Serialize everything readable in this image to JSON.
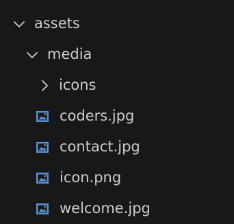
{
  "colors": {
    "background": "#181818",
    "text": "#cccccc",
    "image_icon": "#5b8fd6"
  },
  "tree": [
    {
      "label": "assets",
      "type": "folder",
      "expanded": true,
      "icon": "chevron-down-icon"
    },
    {
      "label": "media",
      "type": "folder",
      "expanded": true,
      "icon": "chevron-down-icon"
    },
    {
      "label": "icons",
      "type": "folder",
      "expanded": false,
      "icon": "chevron-right-icon"
    },
    {
      "label": "coders.jpg",
      "type": "file",
      "icon": "image-file-icon"
    },
    {
      "label": "contact.jpg",
      "type": "file",
      "icon": "image-file-icon"
    },
    {
      "label": "icon.png",
      "type": "file",
      "icon": "image-file-icon"
    },
    {
      "label": "welcome.jpg",
      "type": "file",
      "icon": "image-file-icon"
    }
  ]
}
